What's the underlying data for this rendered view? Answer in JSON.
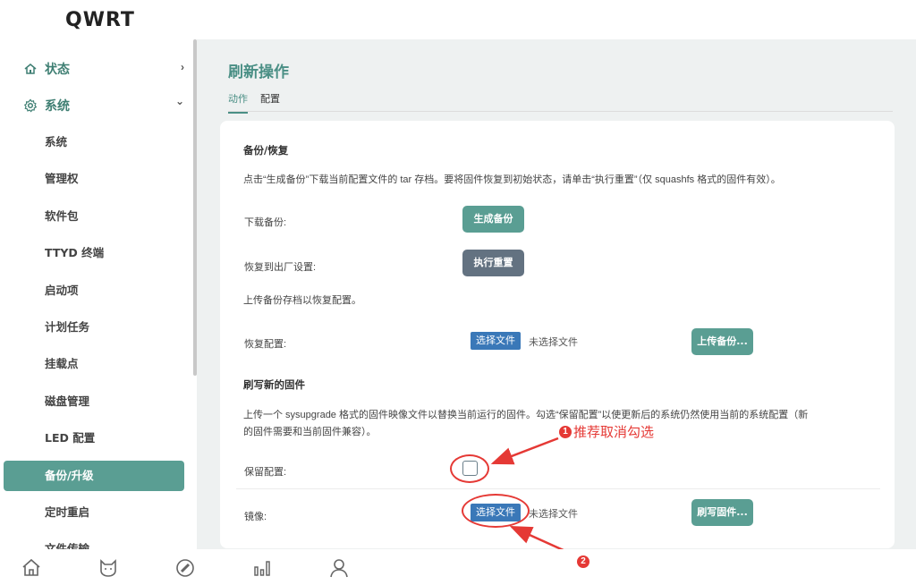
{
  "app": {
    "brand": "QWRT"
  },
  "sidebar": {
    "top_items": [
      {
        "label": "状态",
        "chevron": "›"
      },
      {
        "label": "系统",
        "chevron": "⌄"
      }
    ],
    "sub_items": [
      {
        "label": "系统"
      },
      {
        "label": "管理权"
      },
      {
        "label": "软件包"
      },
      {
        "label": "TTYD 终端"
      },
      {
        "label": "启动项"
      },
      {
        "label": "计划任务"
      },
      {
        "label": "挂载点"
      },
      {
        "label": "磁盘管理"
      },
      {
        "label": "LED 配置"
      },
      {
        "label": "备份/升级"
      },
      {
        "label": "定时重启"
      },
      {
        "label": "文件传输"
      }
    ],
    "active": "备份/升级"
  },
  "page": {
    "title": "刷新操作",
    "tabs": [
      {
        "label": "动作"
      },
      {
        "label": "配置"
      }
    ]
  },
  "backup": {
    "title": "备份/恢复",
    "description": "点击“生成备份”下载当前配置文件的 tar 存档。要将固件恢复到初始状态，请单击“执行重置”（仅 squashfs 格式的固件有效）。",
    "download_label": "下载备份:",
    "download_button": "生成备份",
    "reset_label": "恢复到出厂设置:",
    "reset_button": "执行重置",
    "upload_hint": "上传备份存档以恢复配置。",
    "restore_label": "恢复配置:",
    "choose_file": "选择文件",
    "no_file": "未选择文件",
    "upload_button": "上传备份..."
  },
  "flash": {
    "title": "刷写新的固件",
    "description_line1": "上传一个 sysupgrade 格式的固件映像文件以替换当前运行的固件。勾选“保留配置”以使更新后的系统仍然使用当前的系统配置（新",
    "description_line2": "的固件需要和当前固件兼容）。",
    "keep_label": "保留配置:",
    "keep_checked": false,
    "image_label": "镜像:",
    "choose_file": "选择文件",
    "no_file": "未选择文件",
    "flash_button": "刷写固件..."
  },
  "annotations": {
    "badge1": "1",
    "note1": "推荐取消勾选",
    "badge2": "2",
    "color": "#e53935"
  },
  "bottom_bar": {
    "icons": [
      "home-icon",
      "cat-icon",
      "compass-icon",
      "bar-chart-icon",
      "user-icon"
    ]
  },
  "colors": {
    "accent": "#5a9e93",
    "title": "#4a8f85",
    "gray_button": "#637281",
    "file_button": "#3a78b8"
  }
}
